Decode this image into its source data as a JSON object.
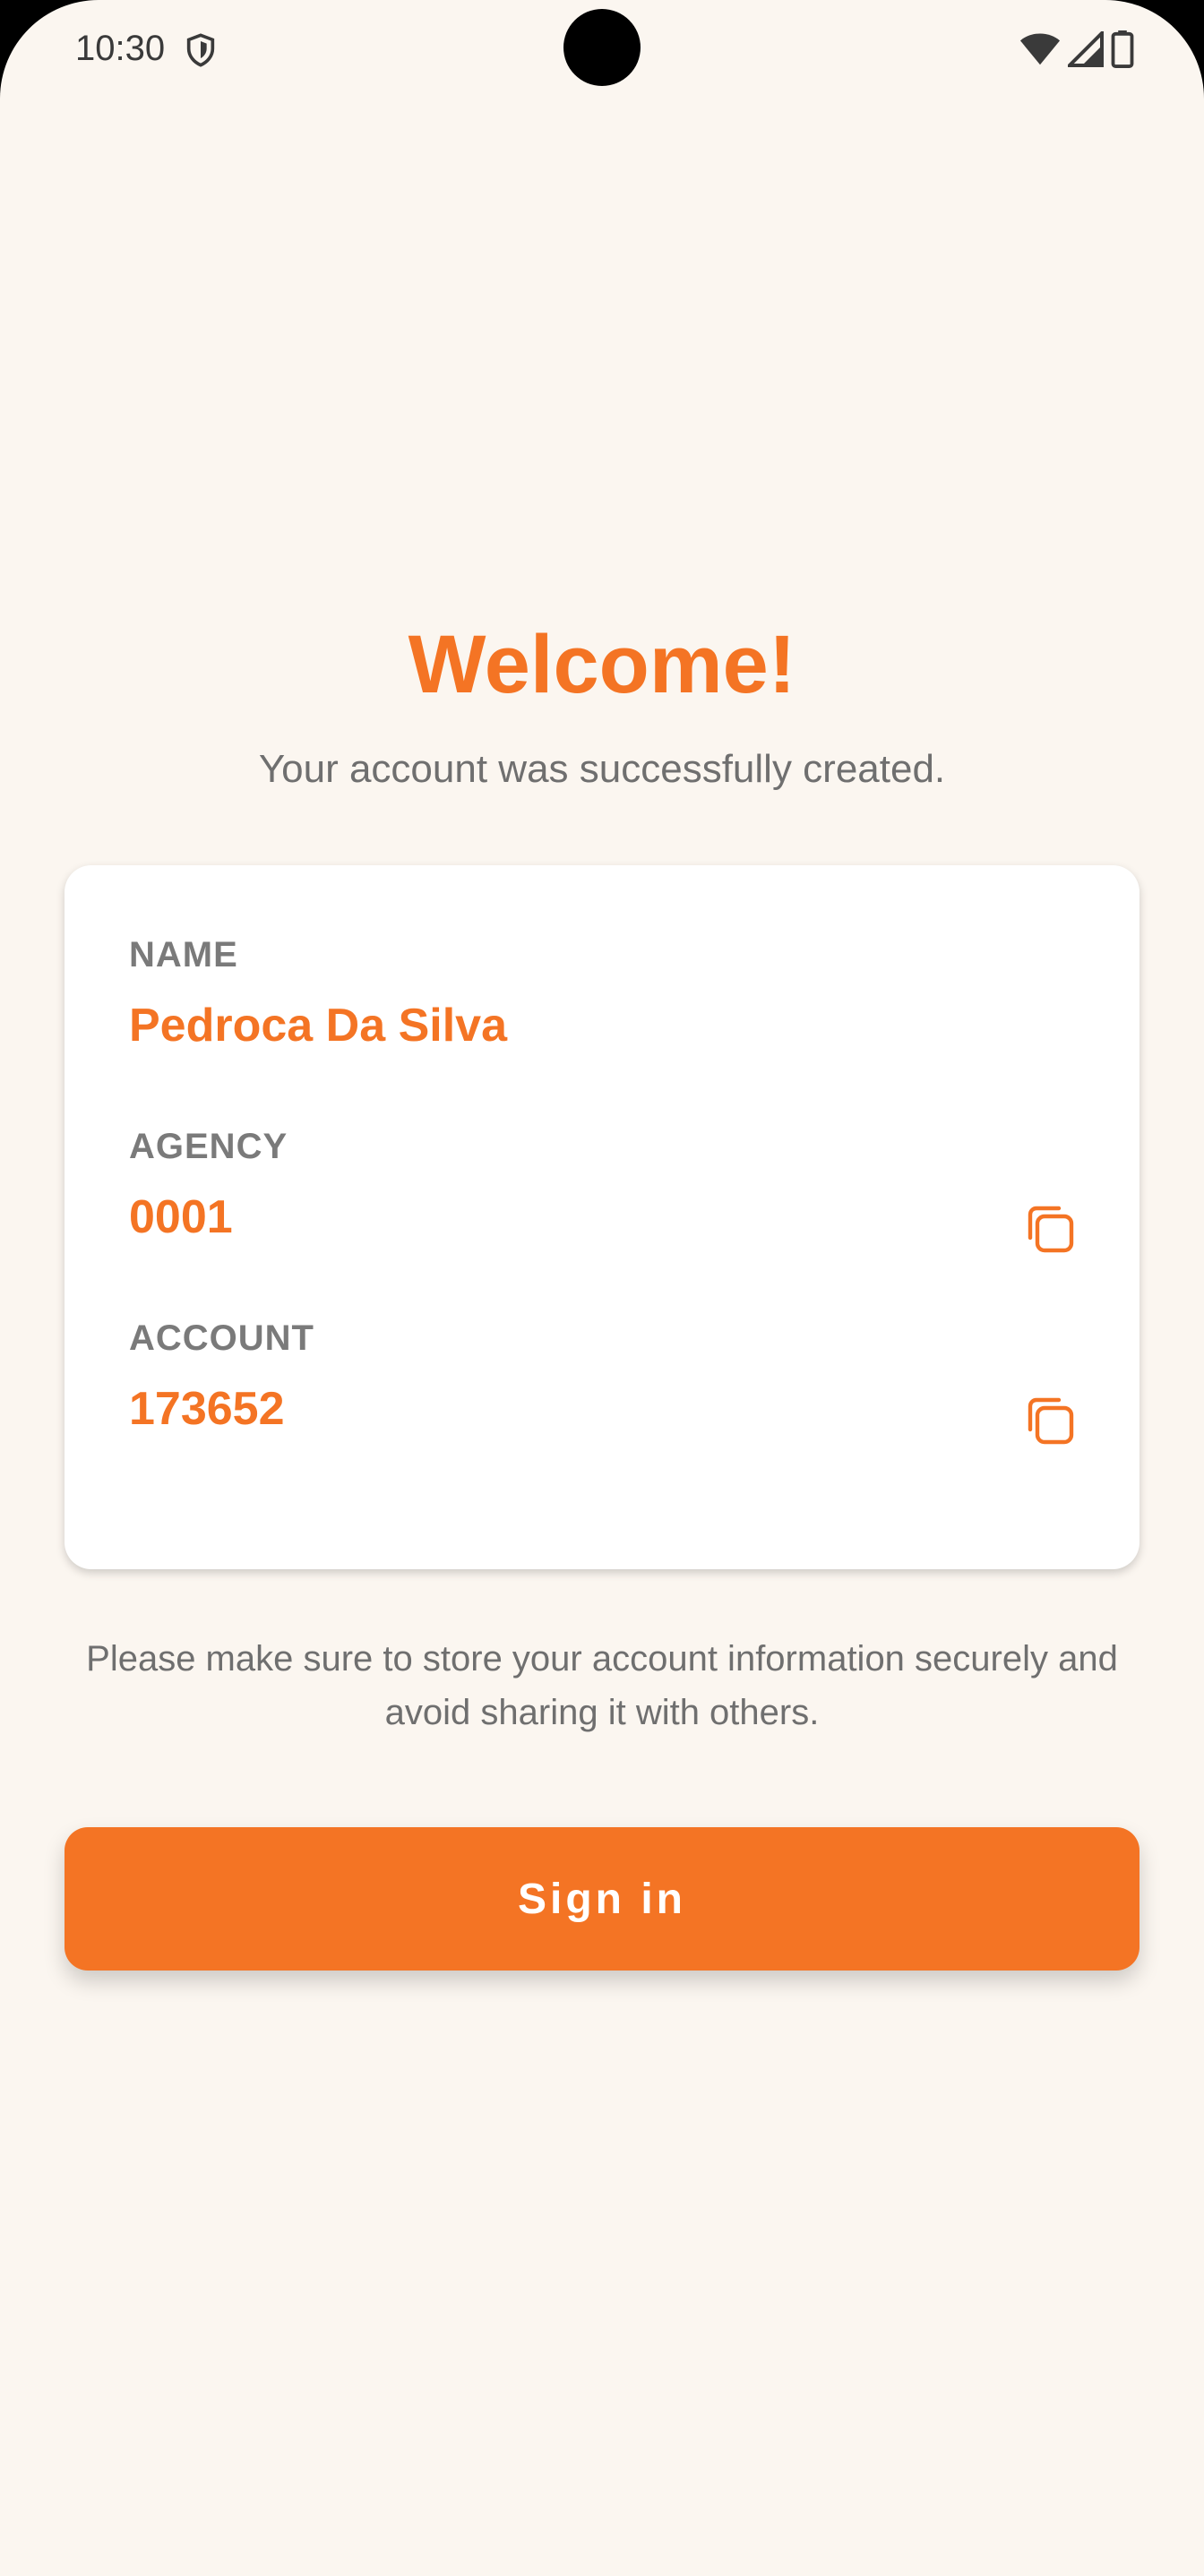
{
  "status_bar": {
    "time": "10:30",
    "icons": [
      "shield-icon",
      "wifi-icon",
      "signal-icon",
      "battery-icon"
    ]
  },
  "welcome": {
    "title": "Welcome!",
    "subtitle": "Your account was successfully created."
  },
  "account_card": {
    "name": {
      "label": "NAME",
      "value": "Pedroca Da Silva"
    },
    "agency": {
      "label": "AGENCY",
      "value": "0001"
    },
    "account": {
      "label": "ACCOUNT",
      "value": "173652"
    }
  },
  "notice": "Please make sure to store your account information securely and avoid sharing it with others.",
  "signin_button": {
    "label": "Sign in"
  },
  "colors": {
    "accent": "#F47424",
    "background": "#FBF6F0",
    "card": "#FFFFFF",
    "muted_text": "#6F6F6F"
  }
}
